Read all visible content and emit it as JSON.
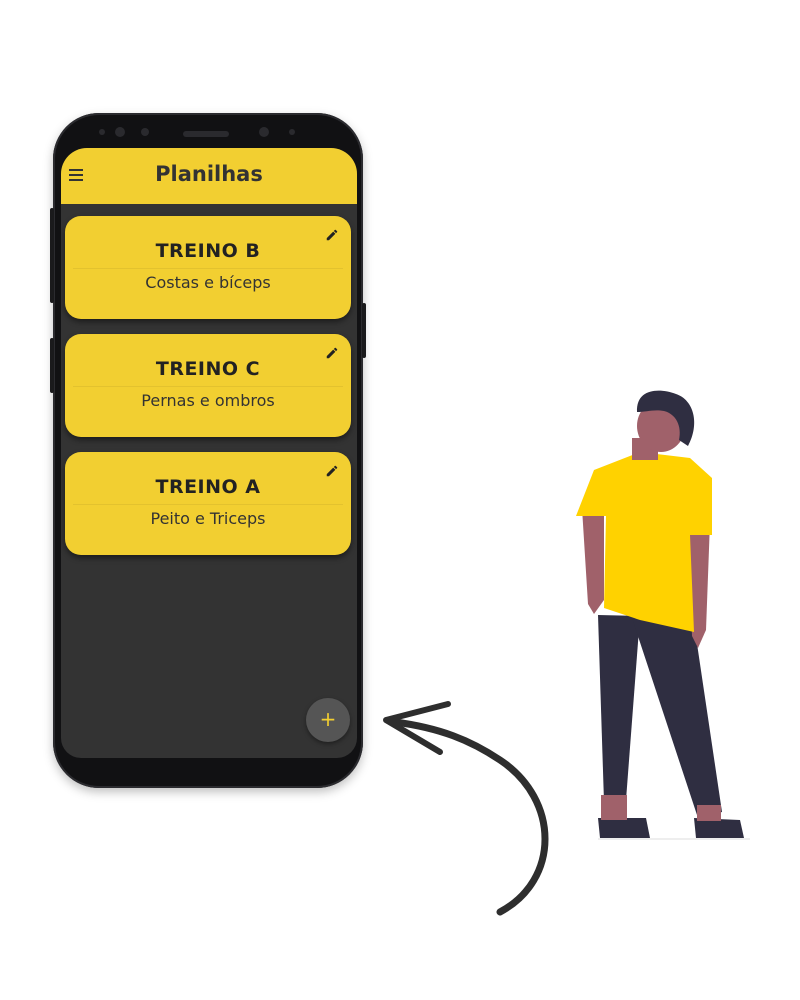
{
  "app": {
    "title": "Planilhas"
  },
  "icons": {
    "menu": "menu-icon",
    "edit": "pencil-icon",
    "add": "plus-icon"
  },
  "colors": {
    "accent": "#f2cf31",
    "background": "#333333",
    "fab": "#555555"
  },
  "cards": [
    {
      "title": "TREINO B",
      "subtitle": "Costas e bíceps"
    },
    {
      "title": "TREINO C",
      "subtitle": "Pernas e ombros"
    },
    {
      "title": "TREINO A",
      "subtitle": "Peito e Triceps"
    }
  ],
  "fab": {
    "label": "+"
  }
}
